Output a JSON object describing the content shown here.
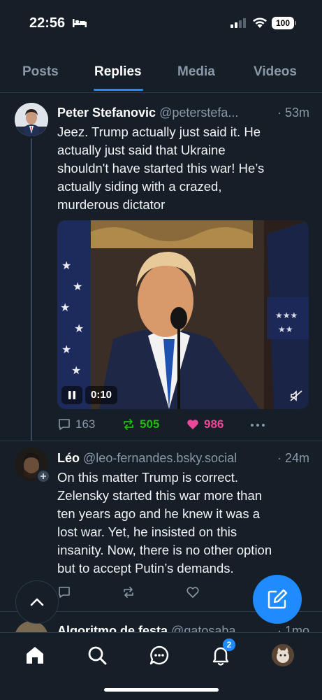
{
  "status_bar": {
    "time": "22:56",
    "battery": "100"
  },
  "tabs": [
    {
      "label": "Posts",
      "active": false
    },
    {
      "label": "Replies",
      "active": true
    },
    {
      "label": "Media",
      "active": false
    },
    {
      "label": "Videos",
      "active": false
    }
  ],
  "posts": [
    {
      "author_name": "Peter Stefanovic",
      "handle": "@peterstefa...",
      "time": "· 53m",
      "text_lines": [
        "Jeez. Trump actually just said it. He",
        "actually just said that Ukraine",
        "shouldn't have started this war! He’s",
        "actually siding with a crazed,",
        "murderous dictator"
      ],
      "video": {
        "time_label": "0:10",
        "state": "playing",
        "muted": true
      },
      "replies": "163",
      "reposts": "505",
      "likes": "986",
      "reposted_by_me": true,
      "liked_by_me": true
    },
    {
      "author_name": "Léo",
      "handle": "@leo-fernandes.bsky.social",
      "time": "· 24m",
      "text_lines": [
        "On this matter Trump is correct.",
        "Zelensky started this war more than",
        "ten years ago and he knew it was a",
        "lost war. Yet, he insisted on this",
        "insanity. Now, there is no other option",
        "but to accept Putin’s demands."
      ]
    },
    {
      "author_name": "Algoritmo de festa",
      "handle": "@gatosaba...",
      "time": "· 1mo"
    }
  ],
  "bottom_nav": {
    "items": [
      "home-icon",
      "search-icon",
      "chat-icon",
      "notifications-icon",
      "profile-avatar"
    ],
    "notifications_badge": "2",
    "active": "home"
  },
  "colors": {
    "background": "#161e27",
    "accent": "#208bfe",
    "repost_green": "#20bc07",
    "like_pink": "#ec4899",
    "muted_text": "#8a98a8"
  }
}
